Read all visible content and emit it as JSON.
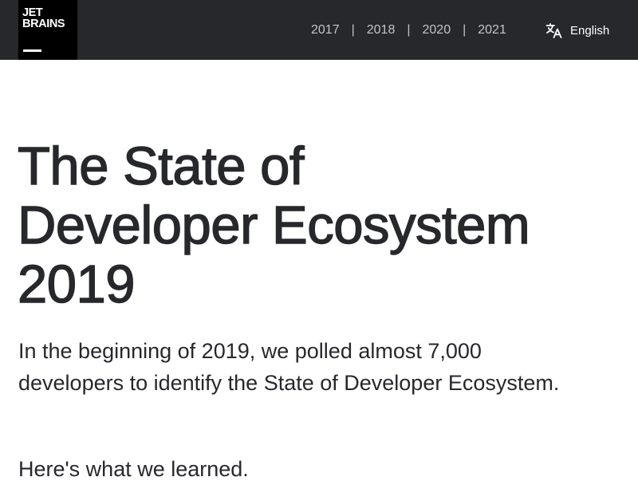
{
  "header": {
    "logo": {
      "line1": "JET",
      "line2": "BRAINS"
    },
    "years": [
      {
        "label": "2017"
      },
      {
        "label": "2018"
      },
      {
        "label": "2020"
      },
      {
        "label": "2021"
      }
    ],
    "separator": "|",
    "language": {
      "label": "English",
      "icon": "translate-icon"
    },
    "colors": {
      "background": "#27282c",
      "logo_bg": "#000000",
      "nav_text": "#c3c4c7"
    }
  },
  "hero": {
    "title_lines": [
      "The State of",
      "Developer Ecosystem",
      "2019"
    ],
    "intro": "In the beginning of 2019, we polled almost 7,000 developers to identify the State of Developer Ecosystem.",
    "learned": "Here's what we learned."
  }
}
